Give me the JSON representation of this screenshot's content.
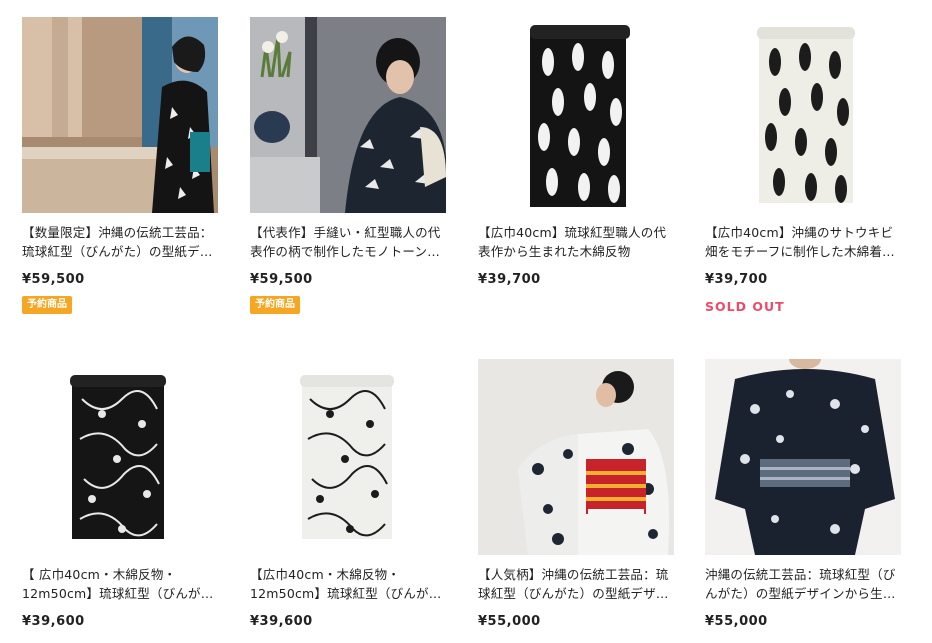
{
  "products": [
    {
      "title": "【数量限定】沖縄の伝統工芸品：琉球紅型（びんがた）の型紙デザイ…",
      "price": "¥59,500",
      "badge": "予約商品",
      "image": "woman-in-black-kimono-photo"
    },
    {
      "title": "【代表作】手縫い・紅型職人の代表作の柄で制作したモノトーン着…",
      "price": "¥59,500",
      "badge": "予約商品",
      "image": "woman-in-kimono-profile-photo"
    },
    {
      "title": "【広巾40cm】琉球紅型職人の代表作から生まれた木綿反物",
      "price": "¥39,700",
      "image": "black-leaf-fabric-roll"
    },
    {
      "title": "【広巾40cm】沖縄のサトウキビ畑をモチーフに制作した木綿着物…",
      "price": "¥39,700",
      "status": "SOLD OUT",
      "image": "white-leaf-fabric-roll"
    },
    {
      "title": "【 広巾40cm・木綿反物・12m50cm】琉球紅型（びんがた）の型紙…",
      "price": "¥39,600",
      "image": "black-floral-fabric-roll"
    },
    {
      "title": "【広巾40cm・木綿反物・12m50cm】琉球紅型（びんがた）の型紙…",
      "price": "¥39,600",
      "image": "white-floral-fabric-roll"
    },
    {
      "title": "【人気柄】沖縄の伝統工芸品：琉球紅型（びんがた）の型紙デザイン…",
      "price": "¥55,000",
      "image": "woman-back-red-obi-photo"
    },
    {
      "title": "沖縄の伝統工芸品：琉球紅型（びんがた）の型紙デザインから生ま…",
      "price": "¥55,000",
      "image": "man-in-yukata-photo"
    }
  ]
}
